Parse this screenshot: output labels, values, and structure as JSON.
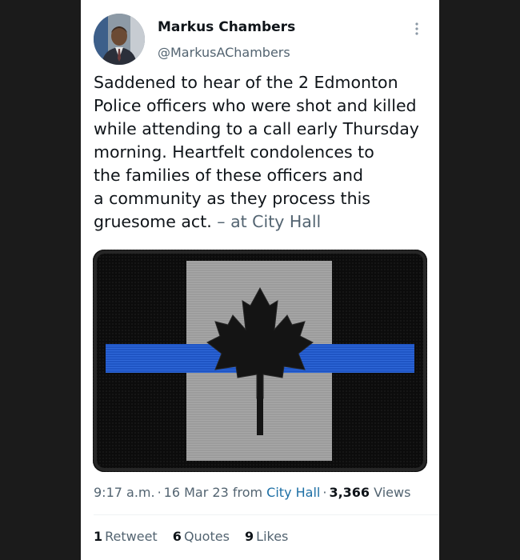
{
  "author": {
    "display_name": "Markus Chambers",
    "handle": "@MarkusAChambers"
  },
  "tweet": {
    "lines": [
      "Saddened to hear of the 2 Edmonton",
      "Police officers who were shot and killed",
      "while attending to a call early Thursday",
      "morning. Heartfelt condolences to",
      "the families of these officers and",
      "a community as they process this",
      "gruesome act."
    ],
    "location_text": "– at City Hall"
  },
  "media": {
    "icon": "thin-blue-line-canada-flag-patch",
    "colors": {
      "patch_black": "#0c0c0c",
      "center_gray": "#9c9c9c",
      "blue_line": "#1f55c4",
      "leaf": "#141414"
    }
  },
  "meta": {
    "time": "9:17 a.m.",
    "date": "16 Mar 23",
    "from_label": "from",
    "place": "City Hall",
    "views_count": "3,366",
    "views_label": "Views"
  },
  "stats": {
    "retweets_count": "1",
    "retweets_label": "Retweet",
    "quotes_count": "6",
    "quotes_label": "Quotes",
    "likes_count": "9",
    "likes_label": "Likes"
  },
  "colors": {
    "page_background": "#1b1b1b",
    "card_background": "#ffffff",
    "text_primary": "#0f1419",
    "text_secondary": "#536471",
    "link": "#1d6fa5"
  }
}
